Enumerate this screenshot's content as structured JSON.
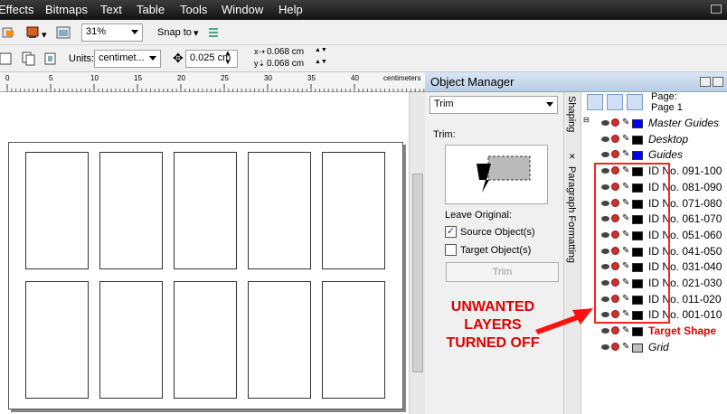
{
  "menu": {
    "items": [
      "Effects",
      "Bitmaps",
      "Text",
      "Table",
      "Tools",
      "Window",
      "Help"
    ],
    "underline": [
      "E",
      "B",
      "x",
      "T",
      "T",
      "W",
      "H"
    ]
  },
  "toolbar": {
    "zoom_value": "31%",
    "snap_to_label": "Snap to"
  },
  "propbar": {
    "units_label": "Units:",
    "units_value": "centimet...",
    "nudge_value": "0.025 cm",
    "dup_x_value": "0.068 cm",
    "dup_y_value": "0.068 cm"
  },
  "ruler": {
    "unit_label": "centimeters",
    "ticks": [
      "0",
      "5",
      "10",
      "15",
      "20",
      "25",
      "30",
      "35",
      "40"
    ]
  },
  "object_manager": {
    "title": "Object Manager",
    "page_label": "Page:",
    "page_value": "Page 1"
  },
  "shaping": {
    "mode": "Trim",
    "trim_label": "Trim:",
    "leave_original_label": "Leave Original:",
    "source_label": "Source Object(s)",
    "source_checked": true,
    "target_label": "Target Object(s)",
    "target_checked": false,
    "trim_button": "Trim"
  },
  "tabs": {
    "shaping": "Shaping",
    "paragraph": "Paragraph Formatting"
  },
  "layers": [
    {
      "name": "Master Guides",
      "color": "#0000ff",
      "italic": true
    },
    {
      "name": "Desktop",
      "color": "#000000",
      "italic": true
    },
    {
      "name": "Guides",
      "color": "#0000ff",
      "italic": true
    },
    {
      "name": "ID No. 091-100",
      "color": "#000000",
      "italic": false
    },
    {
      "name": "ID No. 081-090",
      "color": "#000000",
      "italic": false
    },
    {
      "name": "ID No. 071-080",
      "color": "#000000",
      "italic": false
    },
    {
      "name": "ID No. 061-070",
      "color": "#000000",
      "italic": false
    },
    {
      "name": "ID No. 051-060",
      "color": "#000000",
      "italic": false
    },
    {
      "name": "ID No. 041-050",
      "color": "#000000",
      "italic": false
    },
    {
      "name": "ID No. 031-040",
      "color": "#000000",
      "italic": false
    },
    {
      "name": "ID No. 021-030",
      "color": "#000000",
      "italic": false
    },
    {
      "name": "ID No. 011-020",
      "color": "#000000",
      "italic": false
    },
    {
      "name": "ID No. 001-010",
      "color": "#000000",
      "italic": false
    },
    {
      "name": "Target Shape",
      "color": "#000000",
      "italic": false,
      "highlight": "#e00000"
    },
    {
      "name": "Grid",
      "color": "#c0c0c0",
      "italic": true
    }
  ],
  "annotation": {
    "line1": "UNWANTED",
    "line2": "LAYERS",
    "line3": "TURNED OFF",
    "color": "#e00000"
  }
}
